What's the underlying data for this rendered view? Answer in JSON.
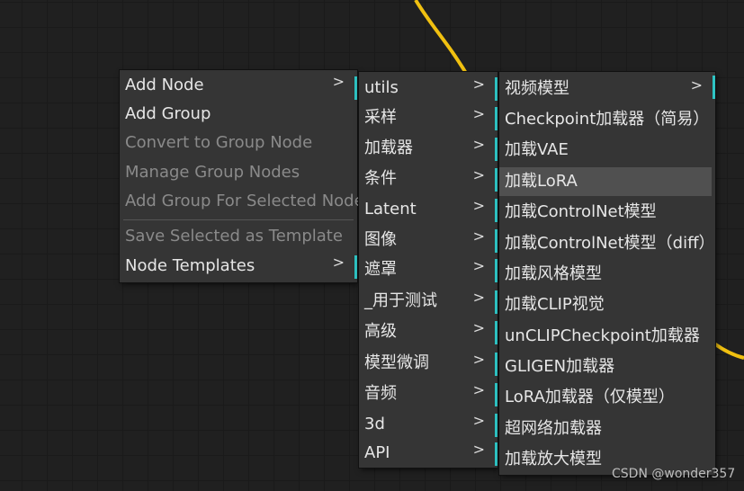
{
  "main_menu": {
    "items": [
      {
        "label": "Add Node",
        "arrow": ">",
        "disabled": false
      },
      {
        "label": "Add Group",
        "arrow": "",
        "disabled": false
      },
      {
        "label": "Convert to Group Node",
        "arrow": "",
        "disabled": true
      },
      {
        "label": "Manage Group Nodes",
        "arrow": "",
        "disabled": true
      },
      {
        "label": "Add Group For Selected Nodes",
        "arrow": "",
        "disabled": true
      },
      {
        "label": "Save Selected as Template",
        "arrow": "",
        "disabled": true
      },
      {
        "label": "Node Templates",
        "arrow": ">",
        "disabled": false
      }
    ]
  },
  "category_menu": {
    "items": [
      {
        "label": "utils",
        "arrow": ">"
      },
      {
        "label": "采样",
        "arrow": ">"
      },
      {
        "label": "加载器",
        "arrow": ">"
      },
      {
        "label": "条件",
        "arrow": ">"
      },
      {
        "label": "Latent",
        "arrow": ">"
      },
      {
        "label": "图像",
        "arrow": ">"
      },
      {
        "label": "遮罩",
        "arrow": ">"
      },
      {
        "label": "_用于测试",
        "arrow": ">"
      },
      {
        "label": "高级",
        "arrow": ">"
      },
      {
        "label": "模型微调",
        "arrow": ">"
      },
      {
        "label": "音频",
        "arrow": ">"
      },
      {
        "label": "3d",
        "arrow": ">"
      },
      {
        "label": "API",
        "arrow": ">"
      }
    ]
  },
  "loader_menu": {
    "items": [
      {
        "label": "视频模型",
        "arrow": ">"
      },
      {
        "label": "Checkpoint加载器（简易）",
        "arrow": ""
      },
      {
        "label": "加载VAE",
        "arrow": ""
      },
      {
        "label": "加载LoRA",
        "arrow": "",
        "highlight": true
      },
      {
        "label": "加载ControlNet模型",
        "arrow": ""
      },
      {
        "label": "加载ControlNet模型（diff）",
        "arrow": ""
      },
      {
        "label": "加载风格模型",
        "arrow": ""
      },
      {
        "label": "加载CLIP视觉",
        "arrow": ""
      },
      {
        "label": "unCLIPCheckpoint加载器",
        "arrow": ""
      },
      {
        "label": "GLIGEN加载器",
        "arrow": ""
      },
      {
        "label": "LoRA加载器（仅模型）",
        "arrow": ""
      },
      {
        "label": "超网络加载器",
        "arrow": ""
      },
      {
        "label": "加载放大模型",
        "arrow": ""
      }
    ]
  },
  "watermark": "CSDN @wonder357",
  "colors": {
    "accent": "#2ec4c4",
    "wire": "#f0c010",
    "menu_bg": "#353535"
  }
}
